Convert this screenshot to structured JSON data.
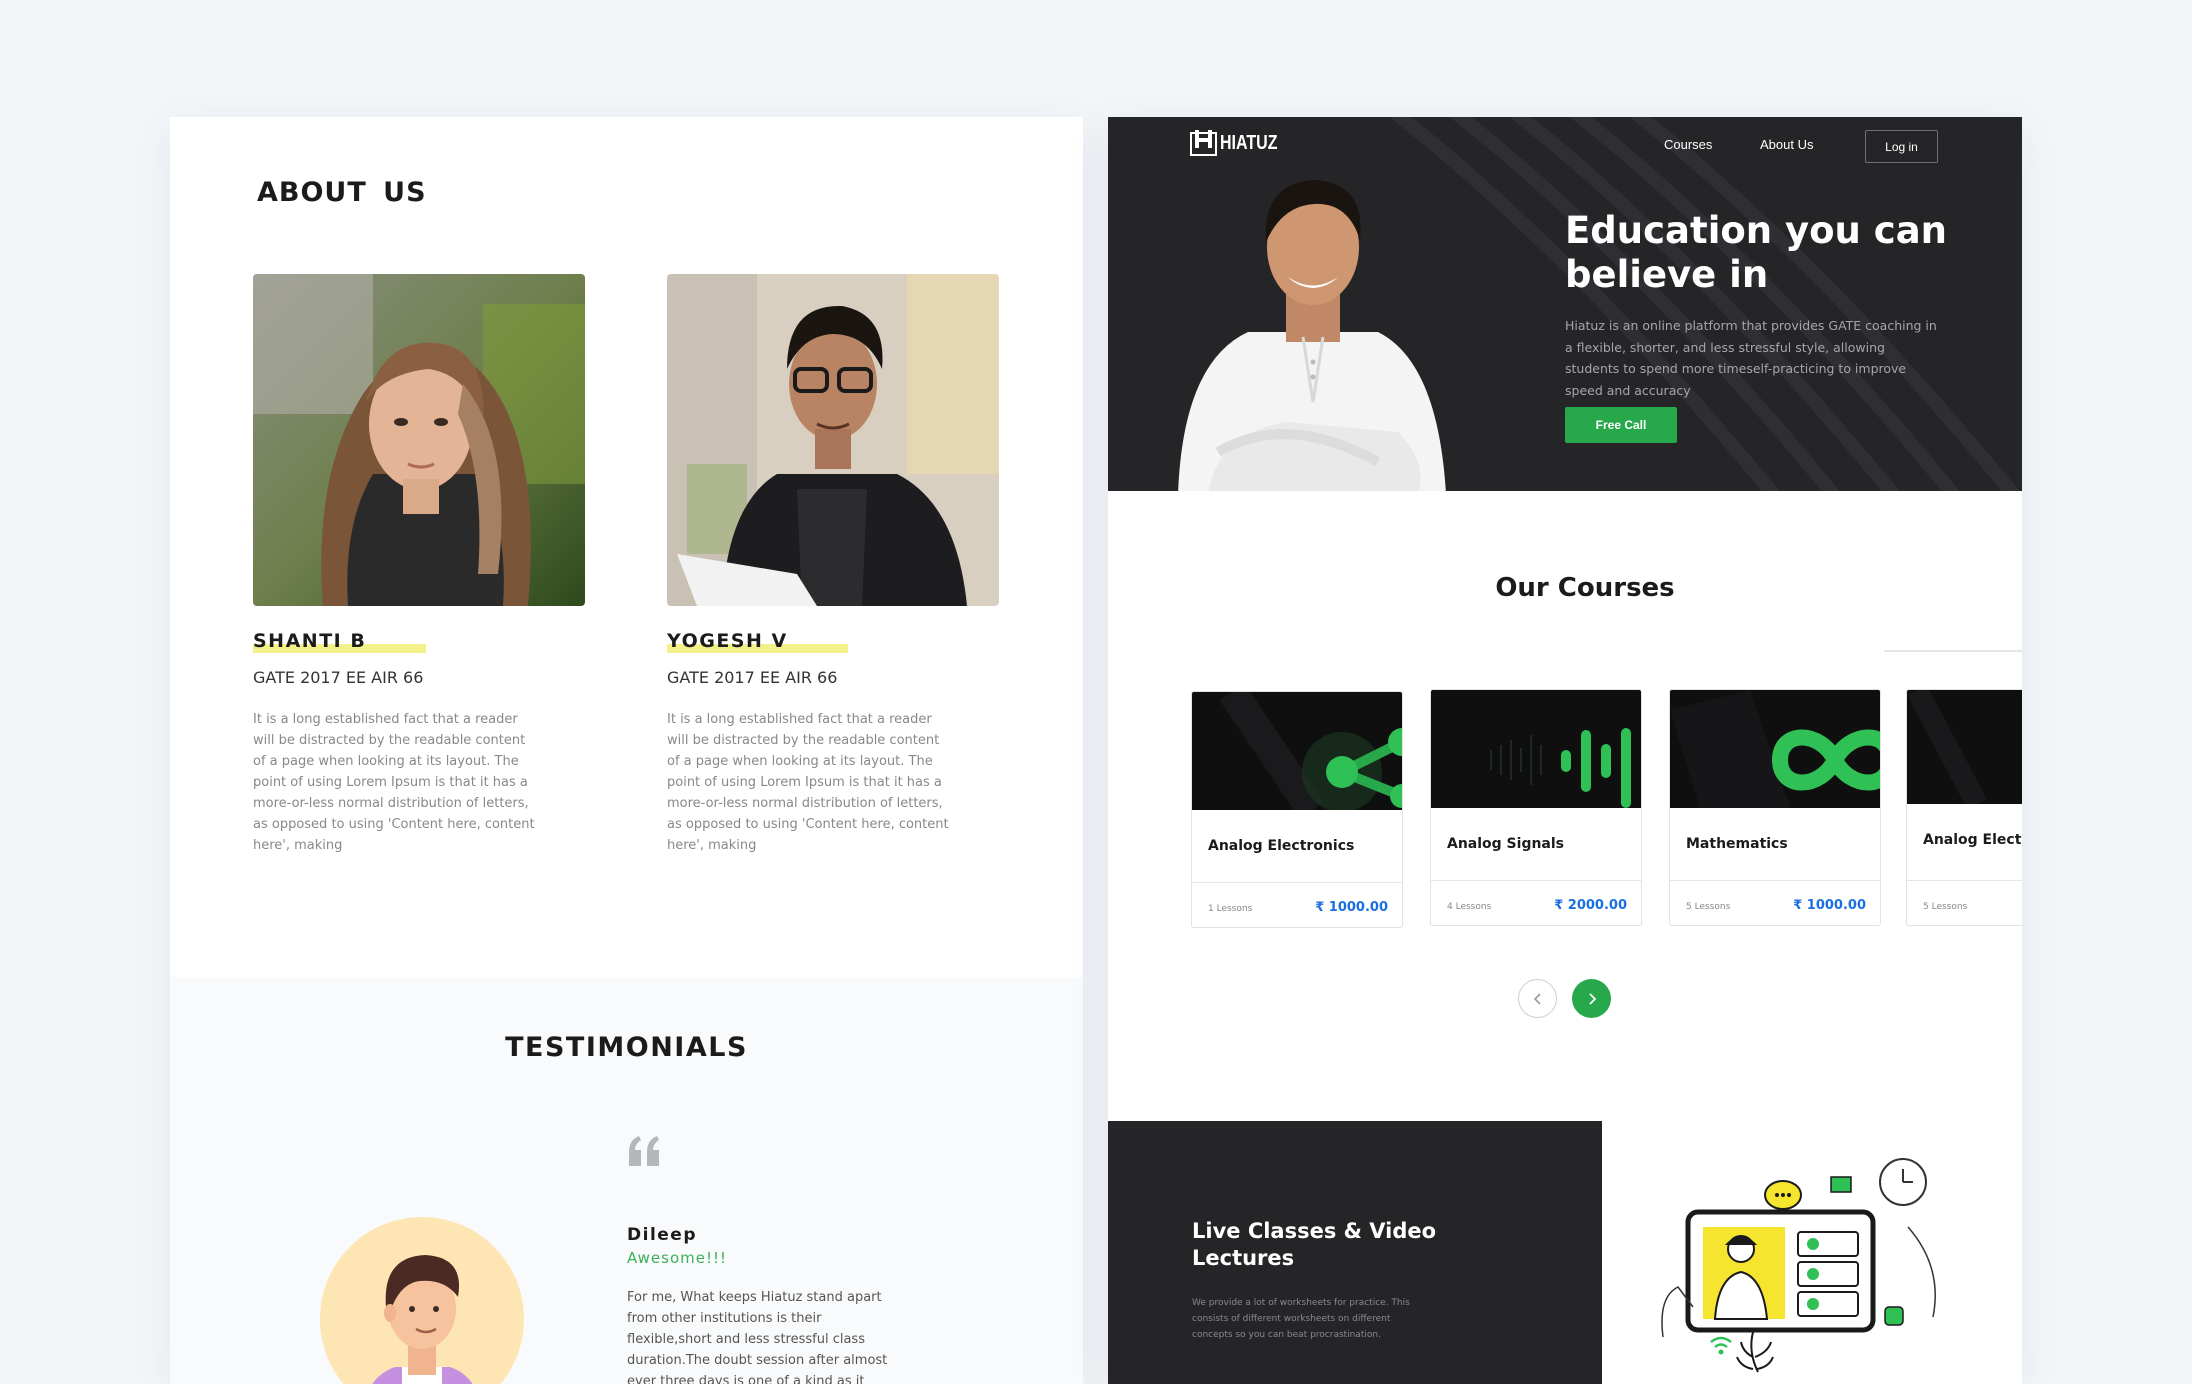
{
  "about": {
    "title": "ABOUT  US",
    "members": [
      {
        "name": "SHANTI B",
        "rank": "GATE 2017 EE AIR 66",
        "bio": "It is a long established fact that a reader will be distracted by the readable content of a page when looking at its layout. The point of using Lorem Ipsum is that it has a more-or-less normal distribution of letters, as opposed to using 'Content here, content here', making"
      },
      {
        "name": "YOGESH V",
        "rank": "GATE 2017 EE AIR 66",
        "bio": "It is a long established fact that a reader will be distracted by the readable content of a page when looking at its layout. The point of using Lorem Ipsum is that it has a more-or-less normal distribution of letters, as opposed to using 'Content here, content here', making"
      }
    ]
  },
  "testimonials": {
    "title": "TESTIMONIALS",
    "quote_icon": "quote-icon",
    "name": "Dileep",
    "tagline": "Awesome!!!",
    "text": "For me, What keeps Hiatuz stand apart from other institutions is their flexible,short and less stressful class duration.The doubt session after almost ever three days is one of a kind as it"
  },
  "site": {
    "logo_text": "HIATUZ",
    "nav": {
      "courses": "Courses",
      "about": "About Us",
      "login": "Log in"
    },
    "hero": {
      "title": "Education you can believe in",
      "description": "Hiatuz is an online platform that provides GATE coaching in a flexible, shorter, and less stressful style, allowing students to spend more timeself-practicing to improve speed and accuracy",
      "cta": "Free Call"
    },
    "courses": {
      "title": "Our Courses",
      "items": [
        {
          "name": "Analog Electronics",
          "lessons": "1 Lessons",
          "price": "₹ 1000.00",
          "icon": "share-nodes-icon"
        },
        {
          "name": "Analog Signals",
          "lessons": "4 Lessons",
          "price": "₹ 2000.00",
          "icon": "signal-bars-icon"
        },
        {
          "name": "Mathematics",
          "lessons": "5 Lessons",
          "price": "₹ 1000.00",
          "icon": "infinity-icon"
        },
        {
          "name": "Analog Electr",
          "lessons": "5 Lessons",
          "price": "",
          "icon": ""
        }
      ]
    },
    "live": {
      "title": "Live Classes & Video Lectures",
      "description": "We provide a lot of worksheets for practice. This consists of different worksheets on different concepts so you can beat procrastination."
    }
  },
  "colors": {
    "accent_green": "#27a84a",
    "dark": "#252427",
    "highlight_yellow": "#f4f18a",
    "price_blue": "#1a6fe0"
  }
}
